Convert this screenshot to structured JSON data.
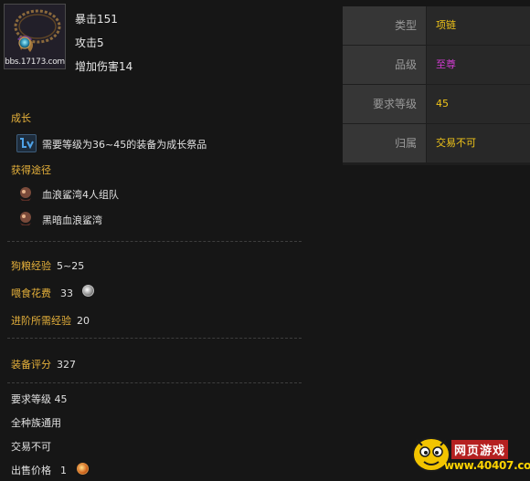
{
  "item": {
    "watermark": "bbs.17173.com",
    "stats": [
      "暴击151",
      "攻击5",
      "增加伤害14"
    ]
  },
  "growth": {
    "heading": "成长",
    "text": "需要等级为36~45的装备为成长祭品"
  },
  "obtain": {
    "heading": "获得途径",
    "sources": [
      "血浪鲨湾4人组队",
      "黑暗血浪鲨湾"
    ]
  },
  "pet": {
    "exp_label": "狗粮经验",
    "exp_value": "5~25",
    "feed_label": "喂食花费",
    "feed_value": "33",
    "advance_label": "进阶所需经验",
    "advance_value": "20"
  },
  "score": {
    "label": "装备评分",
    "value": "327"
  },
  "info": {
    "req_level": "要求等级 45",
    "race": "全种族通用",
    "trade": "交易不可",
    "sell_label": "出售价格",
    "sell_value": "1"
  },
  "attributes": [
    {
      "label": "类型",
      "value": "项链",
      "color": "#f0c419"
    },
    {
      "label": "品级",
      "value": "至尊",
      "color": "#d23cd2"
    },
    {
      "label": "要求等级",
      "value": "45",
      "color": "#f0c419"
    },
    {
      "label": "归属",
      "value": "交易不可",
      "color": "#f0c419"
    }
  ],
  "logo": {
    "title": "网页游戏",
    "url": "www.40407.com"
  }
}
